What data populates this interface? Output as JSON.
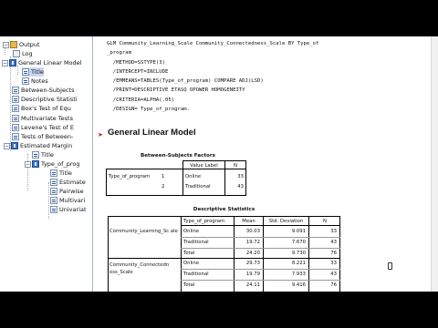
{
  "outline": {
    "items": [
      {
        "label": "Output"
      },
      {
        "label": "Log"
      },
      {
        "label": "General Linear Model"
      },
      {
        "label": "Title"
      },
      {
        "label": "Notes"
      },
      {
        "label": "Between-Subjects"
      },
      {
        "label": "Descriptive Statisti"
      },
      {
        "label": "Box's Test of Equ"
      },
      {
        "label": "Multivariate Tests"
      },
      {
        "label": "Levene's Test of E"
      },
      {
        "label": "Tests of Between-"
      },
      {
        "label": "Estimated Margin"
      },
      {
        "label": "Title"
      },
      {
        "label": "Type_of_prog"
      },
      {
        "label": "Title"
      },
      {
        "label": "Estimate"
      },
      {
        "label": "Pairwise"
      },
      {
        "label": "Multivari"
      },
      {
        "label": "Univariat"
      }
    ]
  },
  "syntax": {
    "lines": [
      "GLM Community_Learning_Scale Community_Connectedness_Scale BY Type_of",
      "_program",
      "  /METHOD=SSTYPE(3)",
      "  /INTERCEPT=INCLUDE",
      "  /EMMEANS=TABLES(Type_of_program) COMPARE ADJ(LSD)",
      "  /PRINT=DESCRIPTIVE ETASQ OPOWER HOMOGENEITY",
      "  /CRITERIA=ALPHA(.05)",
      "  /DESIGN= Type_of_program."
    ]
  },
  "section_title": "General Linear Model",
  "between_subjects": {
    "title": "Between-Subjects Factors",
    "headers": [
      "Value Label",
      "N"
    ],
    "factor": "Type_of_program",
    "rows": [
      {
        "code": "1",
        "label": "Online",
        "n": "33"
      },
      {
        "code": "2",
        "label": "Traditional",
        "n": "43"
      }
    ]
  },
  "descriptives": {
    "title": "Descriptive Statistics",
    "headers": [
      "Type_of_program",
      "Mean",
      "Std. Deviation",
      "N"
    ],
    "groups": [
      {
        "variable": "Community_Learning_Sc ale",
        "rows": [
          {
            "program": "Online",
            "mean": "30.03",
            "sd": "9.091",
            "n": "33"
          },
          {
            "program": "Traditional",
            "mean": "19.72",
            "sd": "7.670",
            "n": "43"
          },
          {
            "program": "Total",
            "mean": "24.20",
            "sd": "9.730",
            "n": "76"
          }
        ]
      },
      {
        "variable": "Community_Connectedn ess_Scale",
        "rows": [
          {
            "program": "Online",
            "mean": "29.73",
            "sd": "8.221",
            "n": "33"
          },
          {
            "program": "Traditional",
            "mean": "19.79",
            "sd": "7.933",
            "n": "43"
          },
          {
            "program": "Total",
            "mean": "24.11",
            "sd": "9.416",
            "n": "76"
          }
        ]
      }
    ]
  }
}
